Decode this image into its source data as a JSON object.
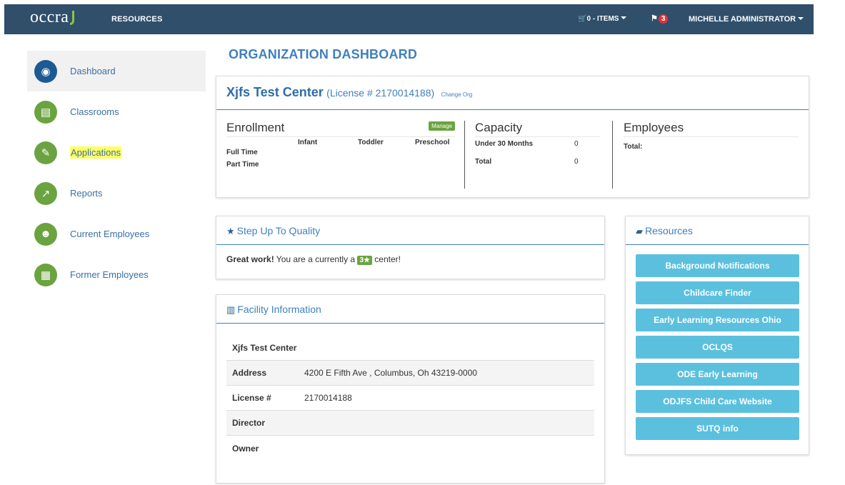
{
  "navbar": {
    "logo": "occra",
    "resources": "RESOURCES",
    "cart": "0 - ITEMS",
    "flag_count": "3",
    "user": "MICHELLE ADMINISTRATOR"
  },
  "sidebar": {
    "items": [
      {
        "label": "Dashboard",
        "icon": "dashboard-icon",
        "glyph": "◉"
      },
      {
        "label": "Classrooms",
        "icon": "book-icon",
        "glyph": "▤"
      },
      {
        "label": "Applications",
        "icon": "edit-icon",
        "glyph": "✎"
      },
      {
        "label": "Reports",
        "icon": "chart-icon",
        "glyph": "↗"
      },
      {
        "label": "Current Employees",
        "icon": "users-icon",
        "glyph": "☻"
      },
      {
        "label": "Former Employees",
        "icon": "calendar-icon",
        "glyph": "▦"
      }
    ]
  },
  "page": {
    "title": "ORGANIZATION DASHBOARD"
  },
  "org": {
    "name": "Xjfs Test Center",
    "license": "(License # 2170014188)",
    "change_org": "Change Org"
  },
  "enrollment": {
    "title": "Enrollment",
    "manage": "Manage",
    "columns": [
      "Infant",
      "Toddler",
      "Preschool"
    ],
    "rows": [
      "Full Time",
      "Part Time"
    ]
  },
  "capacity": {
    "title": "Capacity",
    "rows": [
      {
        "label": "Under 30 Months",
        "value": "0"
      },
      {
        "label": "Total",
        "value": "0"
      }
    ]
  },
  "employees": {
    "title": "Employees",
    "total_label": "Total:"
  },
  "sutq": {
    "title": "Step Up To Quality",
    "bold": "Great work!",
    "text_before": " You are a currently a ",
    "rating": "3★",
    "text_after": " center!"
  },
  "facility": {
    "title": "Facility Information",
    "name": "Xjfs Test Center",
    "rows": [
      {
        "key": "Address",
        "value": "4200 E Fifth Ave , Columbus, Oh 43219-0000"
      },
      {
        "key": "License #",
        "value": "2170014188"
      },
      {
        "key": "Director",
        "value": ""
      },
      {
        "key": "Owner",
        "value": ""
      }
    ]
  },
  "resources": {
    "title": "Resources",
    "links": [
      "Background Notifications",
      "Childcare Finder",
      "Early Learning Resources Ohio",
      "OCLQS",
      "ODE Early Learning",
      "ODJFS Child Care Website",
      "SUTQ info"
    ]
  },
  "colors": {
    "navbar": "#2f4f6b",
    "accent_blue": "#3f7fbf",
    "green": "#6aa33f",
    "resource_btn": "#5bc0de",
    "highlight": "#ffff66"
  }
}
